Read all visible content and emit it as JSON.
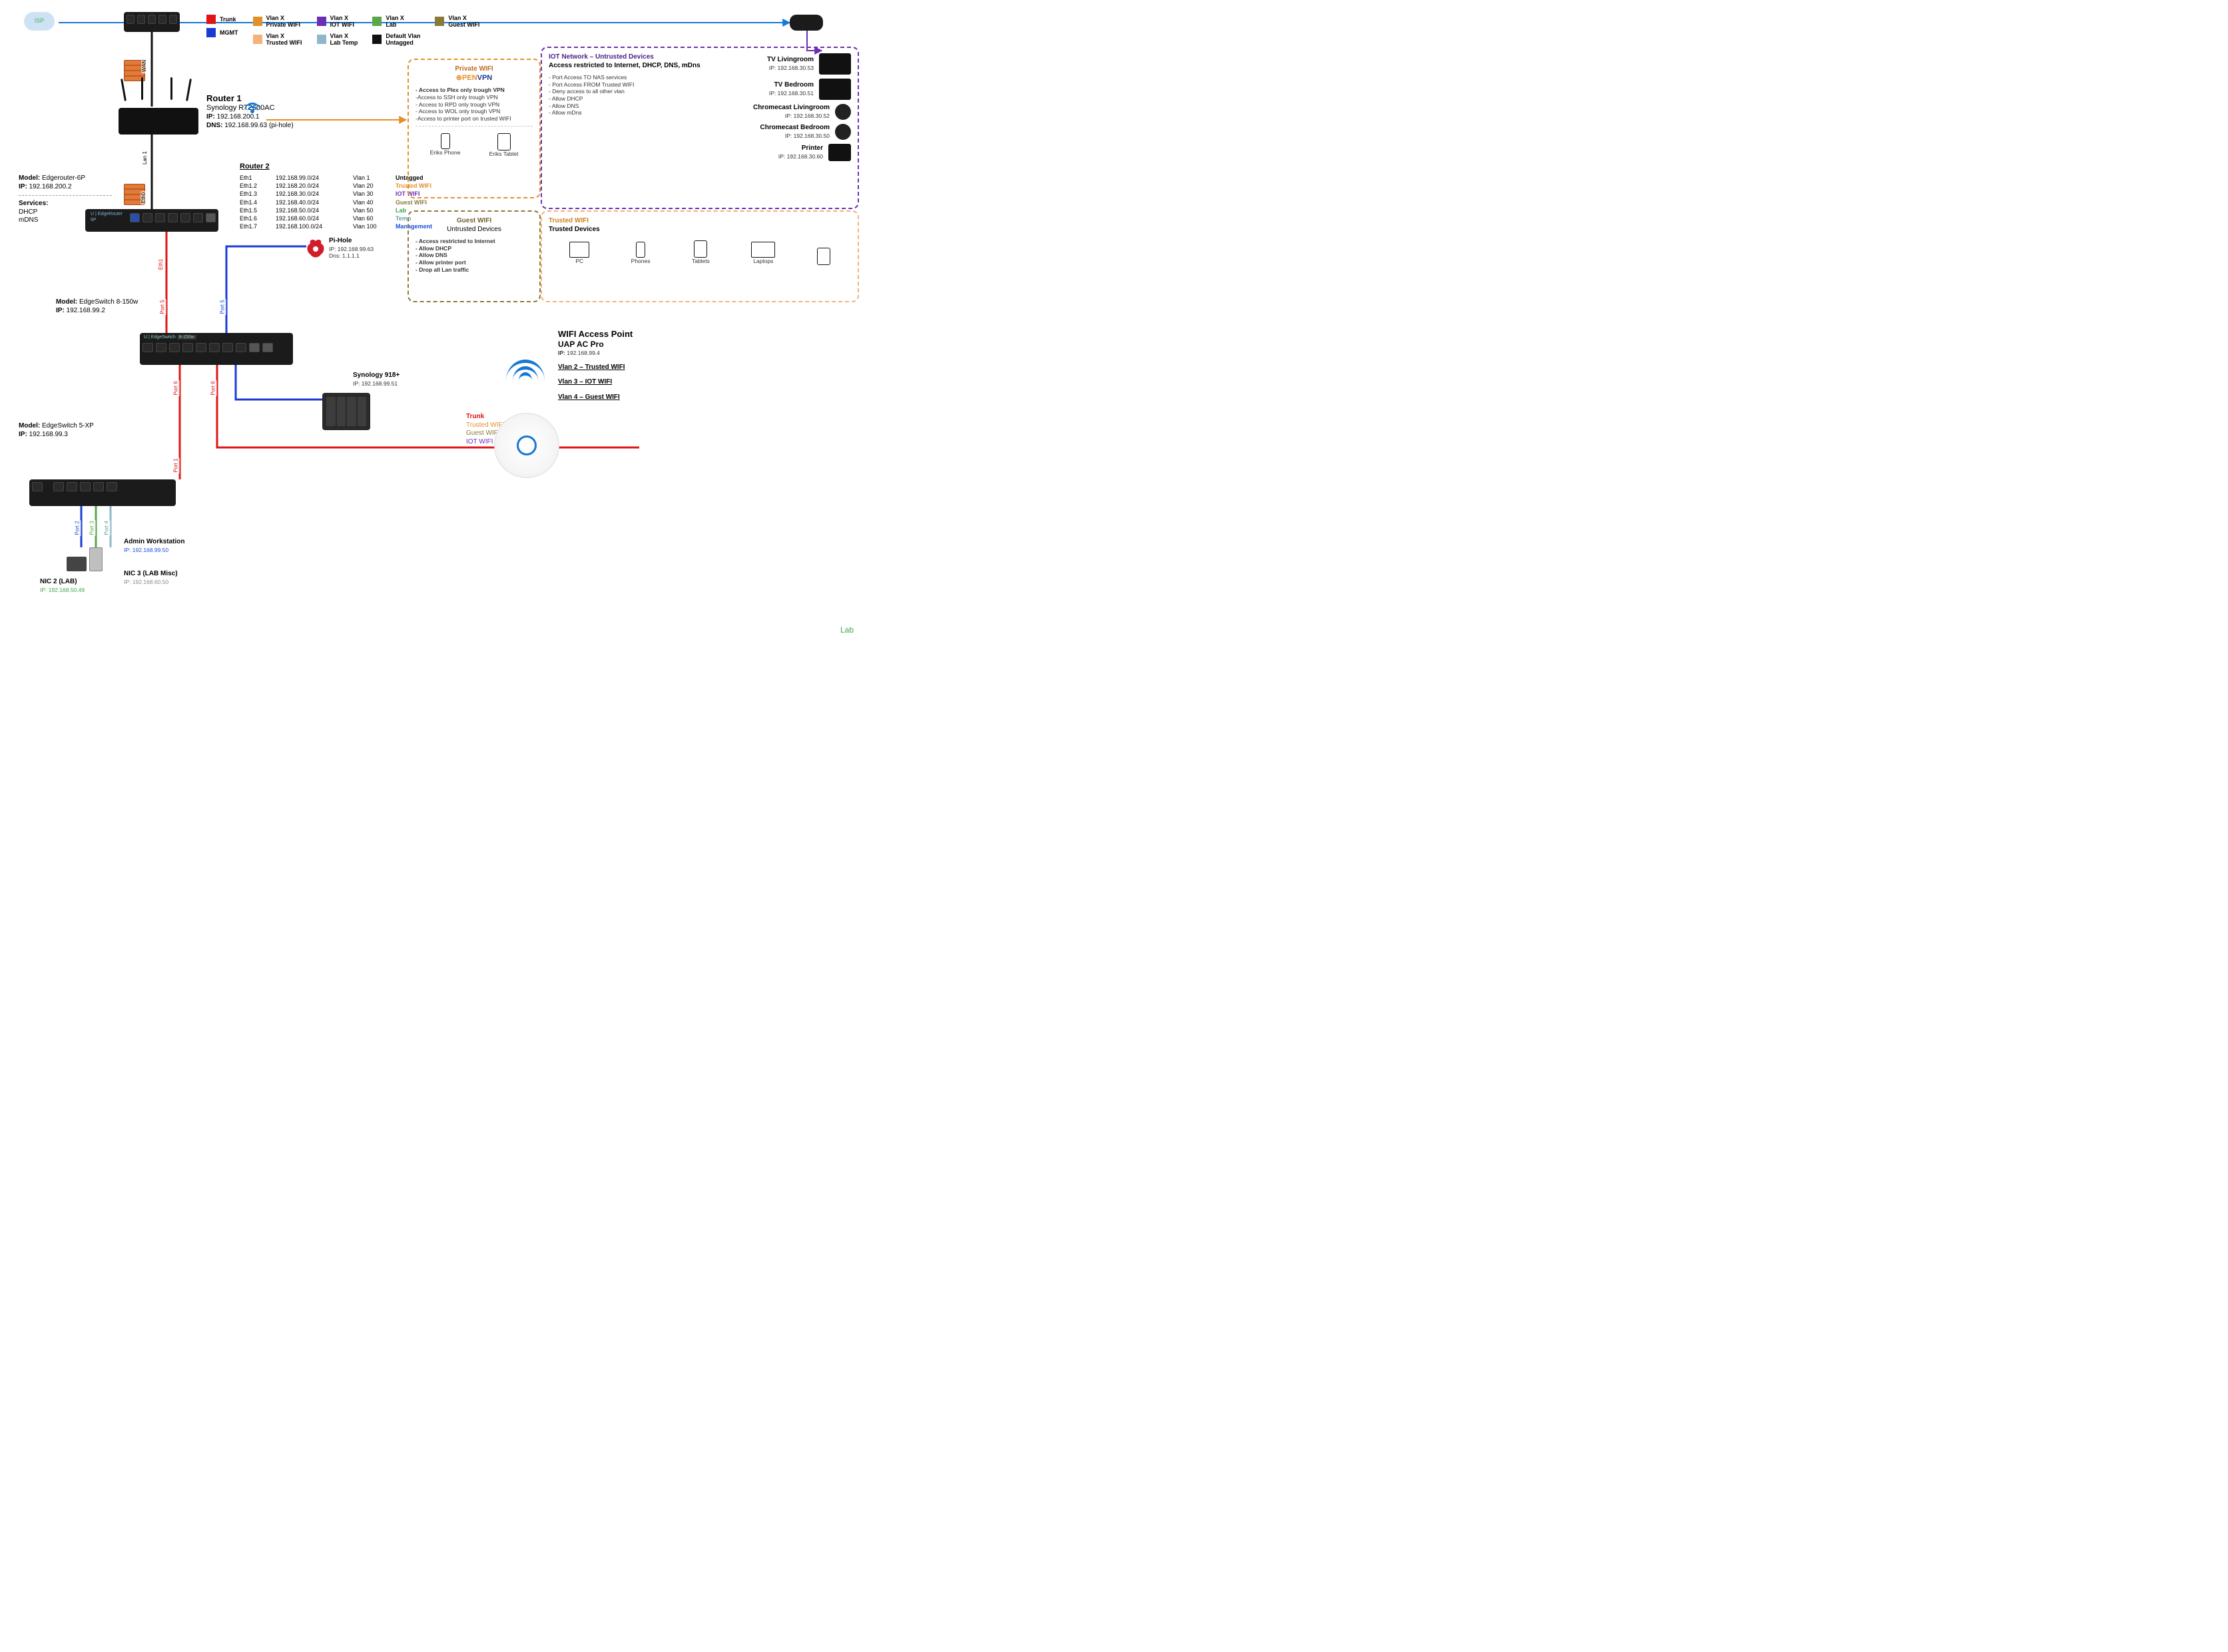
{
  "isp_label": "ISP",
  "legend": {
    "rows": [
      {
        "color": "#e01414",
        "label": "Trunk"
      },
      {
        "color": "#1a3ad6",
        "label": "MGMT"
      },
      {
        "color": "#e38f2a",
        "label": "Vlan X\nPrivate WIFI"
      },
      {
        "color": "#f3b277",
        "label": "Vlan X\nTrusted WIFI"
      },
      {
        "color": "#6b2fb3",
        "label": "Vlan X\nIOT WIFI"
      },
      {
        "color": "#8fb7c9",
        "label": "Vlan X\nLab Temp"
      },
      {
        "color": "#5aa74a",
        "label": "Vlan X\nLab"
      },
      {
        "color": "#111111",
        "label": "Default Vlan\nUntagged"
      },
      {
        "color": "#8a7a3a",
        "label": "Vlan X\nGuest WIFI"
      }
    ]
  },
  "router1": {
    "title": "Router 1",
    "model": "Synology RT2600AC",
    "ip_label": "IP:",
    "ip": "192.168.200.1",
    "dns_label": "DNS:",
    "dns": "192.168.99.63 (pi-hole)"
  },
  "edgerouter": {
    "model_label": "Model:",
    "model": "Edgerouter-6P",
    "ip_label": "IP:",
    "ip": "192.168.200.2",
    "services_label": "Services:",
    "services": [
      "DHCP",
      "mDNS"
    ]
  },
  "router2": {
    "title": "Router 2",
    "rows": [
      {
        "if": "Eth1",
        "cidr": "192.168.99.0/24",
        "vlan": "Vlan 1",
        "role": "Untagged",
        "cls": ""
      },
      {
        "if": "Eth1.2",
        "cidr": "192.168.20.0/24",
        "vlan": "Vlan 20",
        "role": "Trusted WIFI",
        "cls": "orange"
      },
      {
        "if": "Eth1.3",
        "cidr": "192.168.30.0/24",
        "vlan": "Vlan 30",
        "role": "IOT WIFI",
        "cls": "purple"
      },
      {
        "if": "Eth1.4",
        "cidr": "192.168.40.0/24",
        "vlan": "Vlan 40",
        "role": "Guest WIFI",
        "cls": "olive"
      },
      {
        "if": "Eth1.5",
        "cidr": "192.168.50.0/24",
        "vlan": "Vlan 50",
        "role": "Lab",
        "cls": "green"
      },
      {
        "if": "Eth1.6",
        "cidr": "192.168.60.0/24",
        "vlan": "Vlan 60",
        "role": "Temp",
        "cls": "teal"
      },
      {
        "if": "Eth1.7",
        "cidr": "192.168.100.0/24",
        "vlan": "Vlan 100",
        "role": "Management",
        "cls": "blue"
      }
    ]
  },
  "pihole": {
    "title": "Pi-Hole",
    "ip_label": "IP:",
    "ip": "192.168.99.63",
    "dns_label": "Dns:",
    "dns": "1.1.1.1"
  },
  "switch1": {
    "model_label": "Model:",
    "model": "EdgeSwitch 8-150w",
    "ip_label": "IP:",
    "ip": "192.168.99.2"
  },
  "switch2": {
    "model_label": "Model:",
    "model": "EdgeSwitch 5-XP",
    "ip_label": "IP:",
    "ip": "192.168.99.3"
  },
  "nas": {
    "title": "Synology 918+",
    "ip_label": "IP:",
    "ip": "192.168.99.51"
  },
  "ap": {
    "title": "WIFI Access Point",
    "model": "UAP AC Pro",
    "ip_label": "IP:",
    "ip": "192.168.99.4",
    "vlans": [
      "Vlan 2 – Trusted WIFI",
      "Vlan 3 – IOT WIFI",
      "Vlan 4 – Guest WIFI"
    ]
  },
  "trunk_legend": {
    "items": [
      {
        "label": "Trunk",
        "cls": "red bold"
      },
      {
        "label": "Trusted WIFI",
        "cls": "orange"
      },
      {
        "label": "Guest WIFI",
        "cls": "olive"
      },
      {
        "label": "IOT WIFI",
        "cls": "purple"
      }
    ]
  },
  "workstation": {
    "title": "Admin Workstation",
    "ip_label": "IP:",
    "ip": "192.168.99.50",
    "nic2_label": "NIC 2 (LAB)",
    "nic2_ip_label": "IP:",
    "nic2_ip": "192.168.50.49",
    "nic3_label": "NIC 3 (LAB Misc)",
    "nic3_ip_label": "IP:",
    "nic3_ip": "192.168.60.50"
  },
  "private_wifi": {
    "title": "Private WIFI",
    "brand": "OPENVPN",
    "rules": [
      "- Access to Plex only trough VPN",
      "-Access to SSH only trough VPN",
      "- Access to RPD only trough VPN",
      "- Access to WOL only trough VPN",
      "-Access to printer port on trusted WIFI"
    ],
    "devices": [
      "Eriks Phone",
      "Eriks Tablet"
    ]
  },
  "guest_wifi": {
    "title": "Guest WIFI",
    "subtitle": "Untrusted Devices",
    "rules": [
      "- Access restricted to Internet",
      "- Allow DHCP",
      "- Allow DNS",
      "- Allow printer port",
      "- Drop all Lan traffic"
    ]
  },
  "iot": {
    "title": "IOT Network – Untrusted Devices",
    "subtitle": "Access restricted to Internet, DHCP, DNS, mDns",
    "rules": [
      "- Port Access TO NAS services",
      "- Port Access FROM Trusted WIFI",
      "- Deny access to all other vlan",
      "- Allow DHCP",
      "- Allow DNS",
      "- Allow mDns"
    ],
    "devices": [
      {
        "name": "TV Livingroom",
        "ip": "192.168.30.53"
      },
      {
        "name": "TV Bedroom",
        "ip": "192.168.30.51"
      },
      {
        "name": "Chromecast Livingroom",
        "ip": "192.168.30.52"
      },
      {
        "name": "Chromecast Bedroom",
        "ip": "192.168.30.50"
      },
      {
        "name": "Printer",
        "ip": "192.168.30.60"
      }
    ]
  },
  "trusted_wifi": {
    "title": "Trusted WIFI",
    "subtitle": "Trusted Devices",
    "devices": [
      "PC",
      "Phones",
      "Tablets",
      "Laptops"
    ]
  },
  "link_labels": {
    "wan": "WAN",
    "lan1": "Lan 1",
    "eth0": "Eth0",
    "eth1": "Eth1",
    "port5a": "Port 5",
    "port5b": "Port 5",
    "port6": "Port 6",
    "port6b": "Port 6",
    "port1": "Port 1",
    "port2": "Port 2",
    "port3": "Port 3",
    "port4": "Port 4"
  },
  "footer_label": "Lab"
}
